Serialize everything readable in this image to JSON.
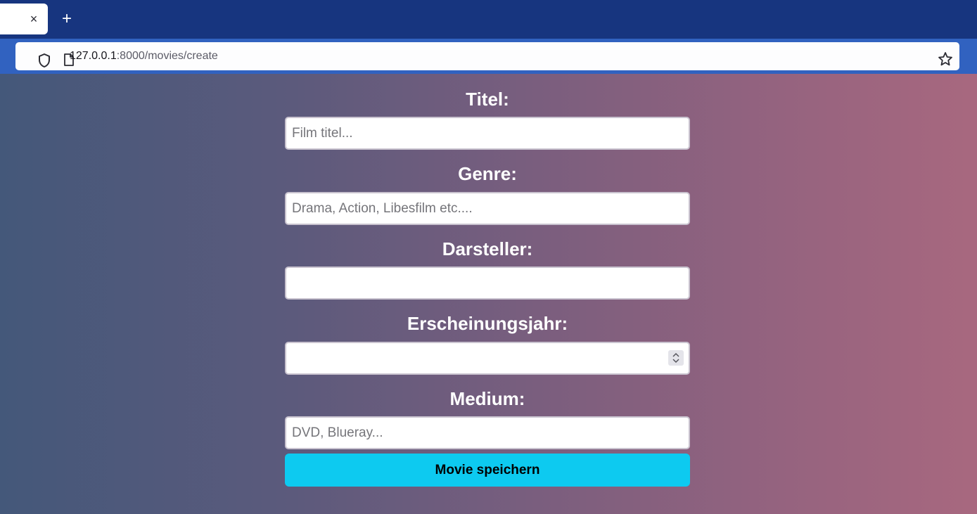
{
  "browser": {
    "tab_close": "×",
    "new_tab": "+",
    "url_host": "127.0.0.1",
    "url_rest": ":8000/movies/create"
  },
  "form": {
    "fields": [
      {
        "label": "Titel:",
        "placeholder": "Film titel...",
        "value": ""
      },
      {
        "label": "Genre:",
        "placeholder": "Drama, Action, Libesfilm etc....",
        "value": ""
      },
      {
        "label": "Darsteller:",
        "placeholder": "",
        "value": ""
      },
      {
        "label": "Erscheinungsjahr:",
        "placeholder": "",
        "value": ""
      },
      {
        "label": "Medium:",
        "placeholder": "DVD, Blueray...",
        "value": ""
      }
    ],
    "submit_label": "Movie speichern"
  },
  "colors": {
    "tabstrip": "#17357f",
    "navbar": "#3162c0",
    "button": "#0dcaf0",
    "gradient_left": "#44587a",
    "gradient_right": "#a8687f"
  }
}
